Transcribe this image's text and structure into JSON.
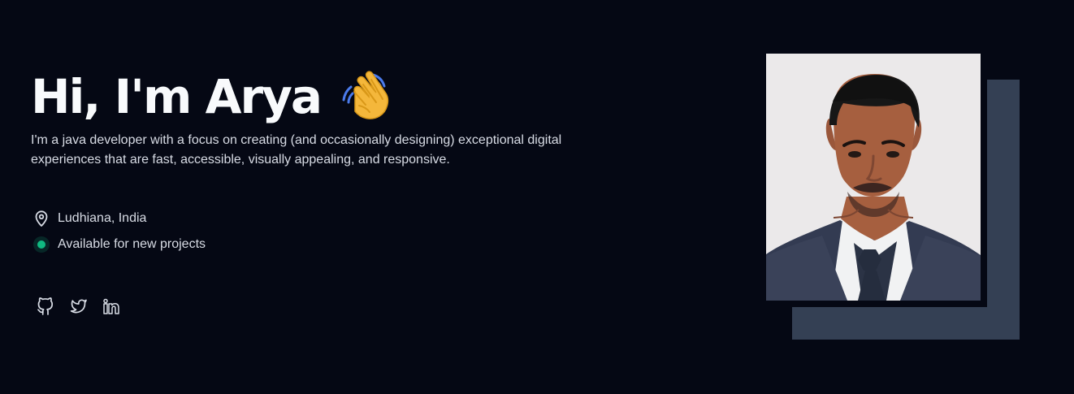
{
  "hero": {
    "title": "Hi, I'm Arya",
    "wave_icon": "waving-hand-icon",
    "intro": "I'm a java developer with a focus on creating (and occasionally designing) exceptional digital experiences that are fast, accessible, visually appealing, and responsive."
  },
  "meta": {
    "location": "Ludhiana, India",
    "location_icon": "location-pin-icon",
    "availability": "Available for new projects",
    "availability_color": "#10b981"
  },
  "social": [
    {
      "icon": "github-icon"
    },
    {
      "icon": "twitter-icon"
    },
    {
      "icon": "linkedin-icon"
    }
  ],
  "colors": {
    "background": "#050814",
    "accent_shadow": "#344054",
    "text": "#d8dce5",
    "heading": "#f8fafc"
  },
  "portrait": {
    "subject": "profile-photo"
  }
}
